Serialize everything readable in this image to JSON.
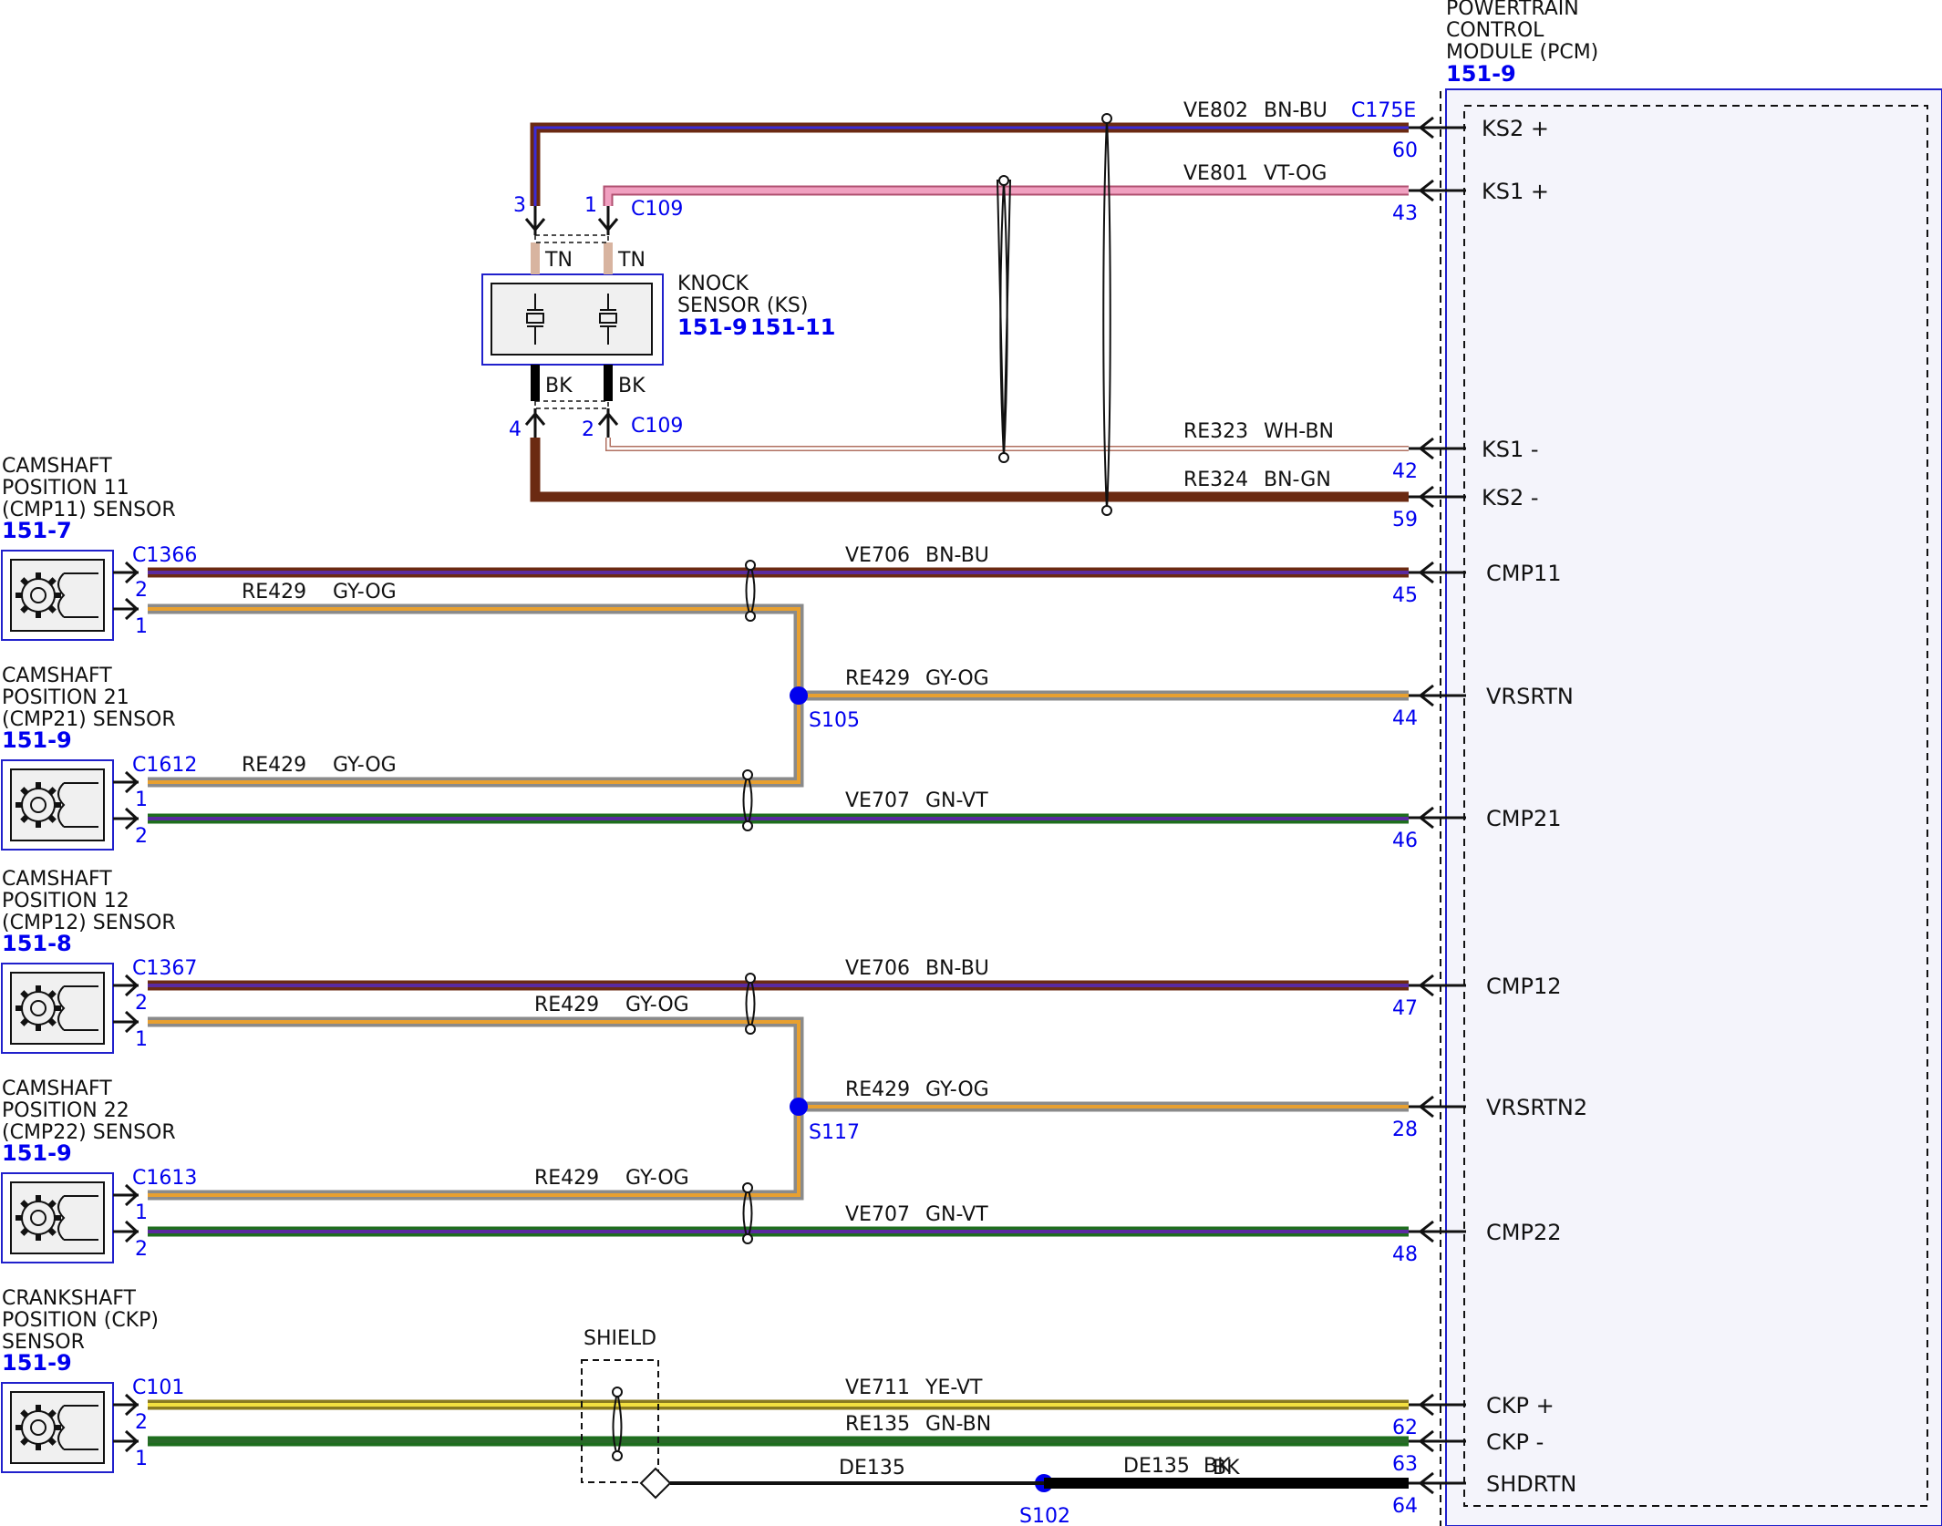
{
  "pcm": {
    "title_lines": [
      "POWERTRAIN",
      "CONTROL",
      "MODULE (PCM)"
    ],
    "ref": "151-9",
    "connector": "C175E"
  },
  "knock_sensor": {
    "title_lines": [
      "KNOCK",
      "SENSOR (KS)"
    ],
    "ref1": "151-9",
    "ref2": "151-11",
    "top_connector": "C109",
    "bottom_connector": "C109",
    "pins": [
      "3",
      "1",
      "4",
      "2"
    ],
    "top_colors": [
      "TN",
      "TN"
    ],
    "bottom_colors": [
      "BK",
      "BK"
    ]
  },
  "sensors": [
    {
      "title_lines": [
        "CAMSHAFT",
        "POSITION 11",
        "(CMP11) SENSOR"
      ],
      "ref": "151-7",
      "connector": "C1366",
      "pin_top": "2",
      "pin_bot": "1"
    },
    {
      "title_lines": [
        "CAMSHAFT",
        "POSITION 21",
        "(CMP21) SENSOR"
      ],
      "ref": "151-9",
      "connector": "C1612",
      "pin_top": "1",
      "pin_bot": "2"
    },
    {
      "title_lines": [
        "CAMSHAFT",
        "POSITION 12",
        "(CMP12) SENSOR"
      ],
      "ref": "151-8",
      "connector": "C1367",
      "pin_top": "2",
      "pin_bot": "1"
    },
    {
      "title_lines": [
        "CAMSHAFT",
        "POSITION 22",
        "(CMP22) SENSOR"
      ],
      "ref": "151-9",
      "connector": "C1613",
      "pin_top": "1",
      "pin_bot": "2"
    },
    {
      "title_lines": [
        "CRANKSHAFT",
        "POSITION (CKP)",
        "SENSOR"
      ],
      "ref": "151-9",
      "connector": "C101",
      "pin_top": "2",
      "pin_bot": "1"
    }
  ],
  "circuits": [
    {
      "circuit": "VE802",
      "color": "BN-BU",
      "pin": "60",
      "pcm_pin": "KS2 +"
    },
    {
      "circuit": "VE801",
      "color": "VT-OG",
      "pin": "43",
      "pcm_pin": "KS1 +"
    },
    {
      "circuit": "RE323",
      "color": "WH-BN",
      "pin": "42",
      "pcm_pin": "KS1 -"
    },
    {
      "circuit": "RE324",
      "color": "BN-GN",
      "pin": "59",
      "pcm_pin": "KS2 -"
    },
    {
      "circuit": "VE706",
      "color": "BN-BU",
      "pin": "45",
      "pcm_pin": "CMP11"
    },
    {
      "circuit": "RE429",
      "color": "GY-OG",
      "pin": "44",
      "pcm_pin": "VRSRTN"
    },
    {
      "circuit": "VE707",
      "color": "GN-VT",
      "pin": "46",
      "pcm_pin": "CMP21"
    },
    {
      "circuit": "VE706",
      "color": "BN-BU",
      "pin": "47",
      "pcm_pin": "CMP12"
    },
    {
      "circuit": "RE429",
      "color": "GY-OG",
      "pin": "28",
      "pcm_pin": "VRSRTN2"
    },
    {
      "circuit": "VE707",
      "color": "GN-VT",
      "pin": "48",
      "pcm_pin": "CMP22"
    },
    {
      "circuit": "VE711",
      "color": "YE-VT",
      "pin": "62",
      "pcm_pin": "CKP +"
    },
    {
      "circuit": "RE135",
      "color": "GN-BN",
      "pin": "63",
      "pcm_pin": "CKP -"
    },
    {
      "circuit": "DE135",
      "color": "BK",
      "pin": "64",
      "pcm_pin": "SHDRTN"
    }
  ],
  "branches": [
    {
      "circuit": "RE429",
      "color": "GY-OG"
    },
    {
      "circuit": "RE429",
      "color": "GY-OG"
    },
    {
      "circuit": "RE429",
      "color": "GY-OG"
    },
    {
      "circuit": "RE429",
      "color": "GY-OG"
    }
  ],
  "splices": [
    "S105",
    "S117",
    "S102"
  ],
  "shield": {
    "label": "SHIELD",
    "drain_circuit": "DE135"
  },
  "wire_colors": {
    "brown": "#6b2a12",
    "blue": "#3b2bd8",
    "violet_pink": "#f0a0c0",
    "white": "#ffffff",
    "grey": "#8a8a8a",
    "orange": "#e8a030",
    "green": "#1e6e1e",
    "violet": "#5a2aa0",
    "yellow": "#f4e040",
    "black": "#000000",
    "tan": "#d8b4a0",
    "accent_blue": "#0000ee"
  }
}
